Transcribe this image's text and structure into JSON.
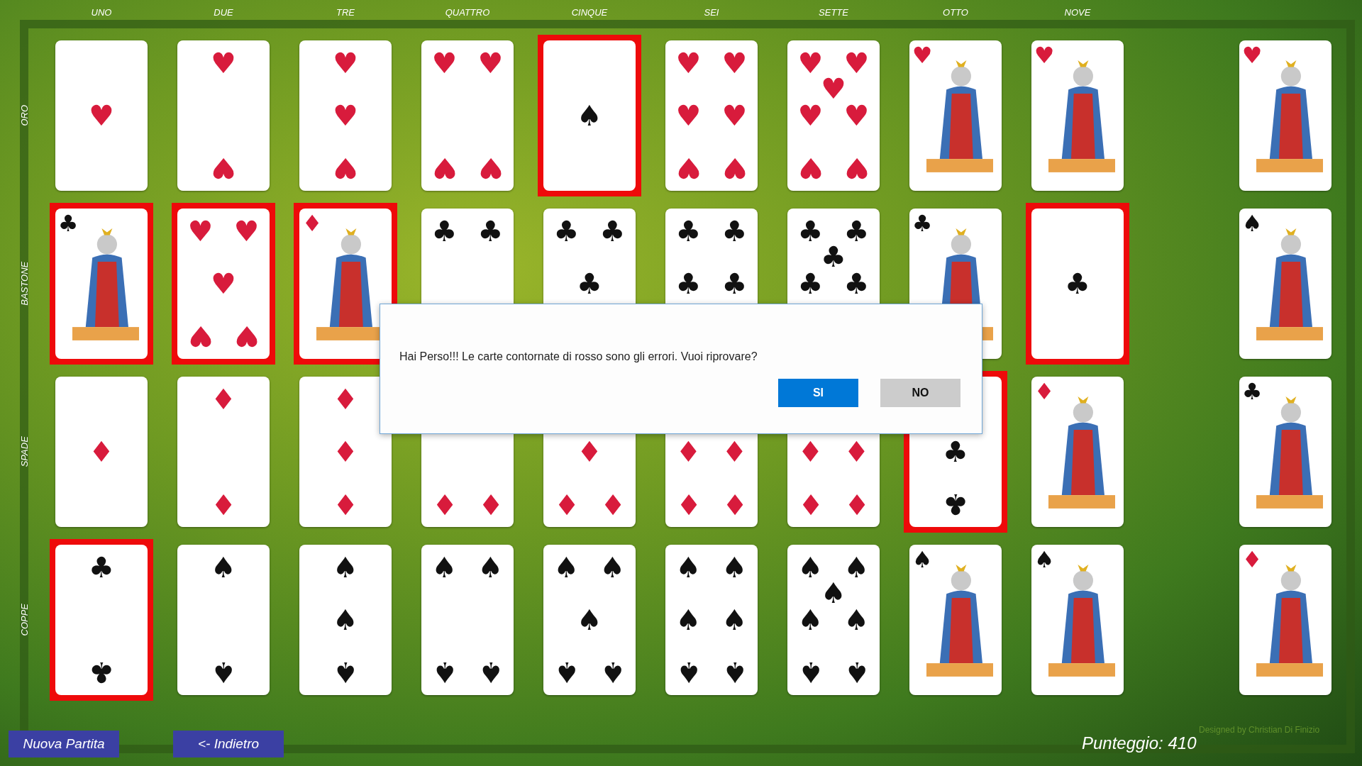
{
  "column_labels": [
    "UNO",
    "DUE",
    "TRE",
    "QUATTRO",
    "CINQUE",
    "SEI",
    "SETTE",
    "OTTO",
    "NOVE"
  ],
  "rows": [
    {
      "label": "ORO",
      "cards": [
        {
          "kind": "pips",
          "color": "#d81b3c",
          "error": false,
          "pips": [
            {
              "glyph": "♥",
              "kind": "center"
            }
          ]
        },
        {
          "kind": "pips",
          "color": "#d81b3c",
          "error": false,
          "pips": [
            {
              "glyph": "♥",
              "kind": "top"
            },
            {
              "glyph": "♥",
              "kind": "bottom"
            }
          ]
        },
        {
          "kind": "pips",
          "color": "#d81b3c",
          "error": false,
          "pips": [
            {
              "glyph": "♥",
              "kind": "top"
            },
            {
              "glyph": "♥",
              "kind": "center"
            },
            {
              "glyph": "♥",
              "kind": "bottom"
            }
          ]
        },
        {
          "kind": "pips",
          "color": "#d81b3c",
          "error": false,
          "pips": [
            {
              "glyph": "♥",
              "kind": "topleft"
            },
            {
              "glyph": "♥",
              "kind": "topright"
            },
            {
              "glyph": "♥",
              "kind": "bottomleft"
            },
            {
              "glyph": "♥",
              "kind": "bottomright"
            }
          ]
        },
        {
          "kind": "pips",
          "color": "#111111",
          "error": true,
          "pips": [
            {
              "glyph": "♠",
              "kind": "center"
            }
          ]
        },
        {
          "kind": "pips",
          "color": "#d81b3c",
          "error": false,
          "pips": [
            {
              "glyph": "♥",
              "kind": "topleft"
            },
            {
              "glyph": "♥",
              "kind": "topright"
            },
            {
              "glyph": "♥",
              "kind": "midleft"
            },
            {
              "glyph": "♥",
              "kind": "midright"
            },
            {
              "glyph": "♥",
              "kind": "bottomleft"
            },
            {
              "glyph": "♥",
              "kind": "bottomright"
            }
          ]
        },
        {
          "kind": "pips",
          "color": "#d81b3c",
          "error": false,
          "pips": [
            {
              "glyph": "♥",
              "kind": "topleft"
            },
            {
              "glyph": "♥",
              "kind": "topright"
            },
            {
              "glyph": "♥",
              "kind": "upper"
            },
            {
              "glyph": "♥",
              "kind": "midleft"
            },
            {
              "glyph": "♥",
              "kind": "midright"
            },
            {
              "glyph": "♥",
              "kind": "bottomleft"
            },
            {
              "glyph": "♥",
              "kind": "bottomright"
            }
          ]
        },
        {
          "kind": "figure",
          "color": "#d81b3c",
          "corner": "♥",
          "error": false
        },
        {
          "kind": "figure",
          "color": "#d81b3c",
          "corner": "♥",
          "error": false
        }
      ],
      "end_card": {
        "kind": "figure",
        "color": "#d81b3c",
        "corner": "♥",
        "error": false
      }
    },
    {
      "label": "BASTONE",
      "cards": [
        {
          "kind": "figure",
          "color": "#111111",
          "corner": "♣",
          "error": true
        },
        {
          "kind": "pips",
          "color": "#d81b3c",
          "error": true,
          "pips": [
            {
              "glyph": "♥",
              "kind": "topleft"
            },
            {
              "glyph": "♥",
              "kind": "topright"
            },
            {
              "glyph": "♥",
              "kind": "center"
            },
            {
              "glyph": "♥",
              "kind": "bottomleft"
            },
            {
              "glyph": "♥",
              "kind": "bottomright"
            }
          ]
        },
        {
          "kind": "figure",
          "color": "#d81b3c",
          "corner": "♦",
          "error": true
        },
        {
          "kind": "pips",
          "color": "#111111",
          "error": false,
          "pips": [
            {
              "glyph": "♣",
              "kind": "topleft"
            },
            {
              "glyph": "♣",
              "kind": "topright"
            }
          ]
        },
        {
          "kind": "pips",
          "color": "#111111",
          "error": false,
          "pips": [
            {
              "glyph": "♣",
              "kind": "topleft"
            },
            {
              "glyph": "♣",
              "kind": "topright"
            },
            {
              "glyph": "♣",
              "kind": "center"
            }
          ]
        },
        {
          "kind": "pips",
          "color": "#111111",
          "error": false,
          "pips": [
            {
              "glyph": "♣",
              "kind": "topleft"
            },
            {
              "glyph": "♣",
              "kind": "topright"
            },
            {
              "glyph": "♣",
              "kind": "midleft"
            },
            {
              "glyph": "♣",
              "kind": "midright"
            }
          ]
        },
        {
          "kind": "pips",
          "color": "#111111",
          "error": false,
          "pips": [
            {
              "glyph": "♣",
              "kind": "topleft"
            },
            {
              "glyph": "♣",
              "kind": "topright"
            },
            {
              "glyph": "♣",
              "kind": "upper"
            },
            {
              "glyph": "♣",
              "kind": "midleft"
            },
            {
              "glyph": "♣",
              "kind": "midright"
            }
          ]
        },
        {
          "kind": "figure",
          "color": "#111111",
          "corner": "♣",
          "error": false
        },
        {
          "kind": "pips",
          "color": "#111111",
          "error": true,
          "pips": [
            {
              "glyph": "♣",
              "kind": "center"
            }
          ]
        }
      ],
      "end_card": {
        "kind": "figure",
        "color": "#111111",
        "corner": "♠",
        "error": false
      }
    },
    {
      "label": "SPADE",
      "cards": [
        {
          "kind": "pips",
          "color": "#d81b3c",
          "error": false,
          "pips": [
            {
              "glyph": "♦",
              "kind": "center"
            }
          ]
        },
        {
          "kind": "pips",
          "color": "#d81b3c",
          "error": false,
          "pips": [
            {
              "glyph": "♦",
              "kind": "top"
            },
            {
              "glyph": "♦",
              "kind": "bottom"
            }
          ]
        },
        {
          "kind": "pips",
          "color": "#d81b3c",
          "error": false,
          "pips": [
            {
              "glyph": "♦",
              "kind": "top"
            },
            {
              "glyph": "♦",
              "kind": "center"
            },
            {
              "glyph": "♦",
              "kind": "bottom"
            }
          ]
        },
        {
          "kind": "pips",
          "color": "#d81b3c",
          "error": false,
          "pips": [
            {
              "glyph": "♦",
              "kind": "bottomleft"
            },
            {
              "glyph": "♦",
              "kind": "bottomright"
            }
          ]
        },
        {
          "kind": "pips",
          "color": "#d81b3c",
          "error": false,
          "pips": [
            {
              "glyph": "♦",
              "kind": "center"
            },
            {
              "glyph": "♦",
              "kind": "bottomleft"
            },
            {
              "glyph": "♦",
              "kind": "bottomright"
            }
          ]
        },
        {
          "kind": "pips",
          "color": "#d81b3c",
          "error": false,
          "pips": [
            {
              "glyph": "♦",
              "kind": "midleft"
            },
            {
              "glyph": "♦",
              "kind": "midright"
            },
            {
              "glyph": "♦",
              "kind": "bottomleft"
            },
            {
              "glyph": "♦",
              "kind": "bottomright"
            }
          ]
        },
        {
          "kind": "pips",
          "color": "#d81b3c",
          "error": false,
          "pips": [
            {
              "glyph": "♦",
              "kind": "midleft"
            },
            {
              "glyph": "♦",
              "kind": "midright"
            },
            {
              "glyph": "♦",
              "kind": "bottomleft"
            },
            {
              "glyph": "♦",
              "kind": "bottomright"
            }
          ]
        },
        {
          "kind": "pips",
          "color": "#111111",
          "error": true,
          "pips": [
            {
              "glyph": "♣",
              "kind": "center"
            },
            {
              "glyph": "♣",
              "kind": "bottom"
            }
          ]
        },
        {
          "kind": "figure",
          "color": "#d81b3c",
          "corner": "♦",
          "error": false
        }
      ],
      "end_card": {
        "kind": "figure",
        "color": "#111111",
        "corner": "♣",
        "error": false
      }
    },
    {
      "label": "COPPE",
      "cards": [
        {
          "kind": "pips",
          "color": "#111111",
          "error": true,
          "pips": [
            {
              "glyph": "♣",
              "kind": "top"
            },
            {
              "glyph": "♣",
              "kind": "bottom"
            }
          ]
        },
        {
          "kind": "pips",
          "color": "#111111",
          "error": false,
          "pips": [
            {
              "glyph": "♠",
              "kind": "top"
            },
            {
              "glyph": "♠",
              "kind": "bottom"
            }
          ]
        },
        {
          "kind": "pips",
          "color": "#111111",
          "error": false,
          "pips": [
            {
              "glyph": "♠",
              "kind": "top"
            },
            {
              "glyph": "♠",
              "kind": "center"
            },
            {
              "glyph": "♠",
              "kind": "bottom"
            }
          ]
        },
        {
          "kind": "pips",
          "color": "#111111",
          "error": false,
          "pips": [
            {
              "glyph": "♠",
              "kind": "topleft"
            },
            {
              "glyph": "♠",
              "kind": "topright"
            },
            {
              "glyph": "♠",
              "kind": "bottomleft"
            },
            {
              "glyph": "♠",
              "kind": "bottomright"
            }
          ]
        },
        {
          "kind": "pips",
          "color": "#111111",
          "error": false,
          "pips": [
            {
              "glyph": "♠",
              "kind": "topleft"
            },
            {
              "glyph": "♠",
              "kind": "topright"
            },
            {
              "glyph": "♠",
              "kind": "center"
            },
            {
              "glyph": "♠",
              "kind": "bottomleft"
            },
            {
              "glyph": "♠",
              "kind": "bottomright"
            }
          ]
        },
        {
          "kind": "pips",
          "color": "#111111",
          "error": false,
          "pips": [
            {
              "glyph": "♠",
              "kind": "topleft"
            },
            {
              "glyph": "♠",
              "kind": "topright"
            },
            {
              "glyph": "♠",
              "kind": "midleft"
            },
            {
              "glyph": "♠",
              "kind": "midright"
            },
            {
              "glyph": "♠",
              "kind": "bottomleft"
            },
            {
              "glyph": "♠",
              "kind": "bottomright"
            }
          ]
        },
        {
          "kind": "pips",
          "color": "#111111",
          "error": false,
          "pips": [
            {
              "glyph": "♠",
              "kind": "topleft"
            },
            {
              "glyph": "♠",
              "kind": "topright"
            },
            {
              "glyph": "♠",
              "kind": "upper"
            },
            {
              "glyph": "♠",
              "kind": "midleft"
            },
            {
              "glyph": "♠",
              "kind": "midright"
            },
            {
              "glyph": "♠",
              "kind": "bottomleft"
            },
            {
              "glyph": "♠",
              "kind": "bottomright"
            }
          ]
        },
        {
          "kind": "figure",
          "color": "#111111",
          "corner": "♠",
          "error": false
        },
        {
          "kind": "figure",
          "color": "#111111",
          "corner": "♠",
          "error": false
        }
      ],
      "end_card": {
        "kind": "figure",
        "color": "#d81b3c",
        "corner": "♦",
        "error": false
      }
    }
  ],
  "dialog": {
    "message": "Hai Perso!!! Le carte contornate di rosso sono gli errori. Vuoi riprovare?",
    "buttons": [
      {
        "label": "SI",
        "kind": "primary"
      },
      {
        "label": "NO",
        "kind": "secondary"
      }
    ]
  },
  "buttons": [
    "Nuova Partita",
    "<- Indietro"
  ],
  "credit": "Designed by Christian Di Finizio",
  "score": "Punteggio: 410"
}
